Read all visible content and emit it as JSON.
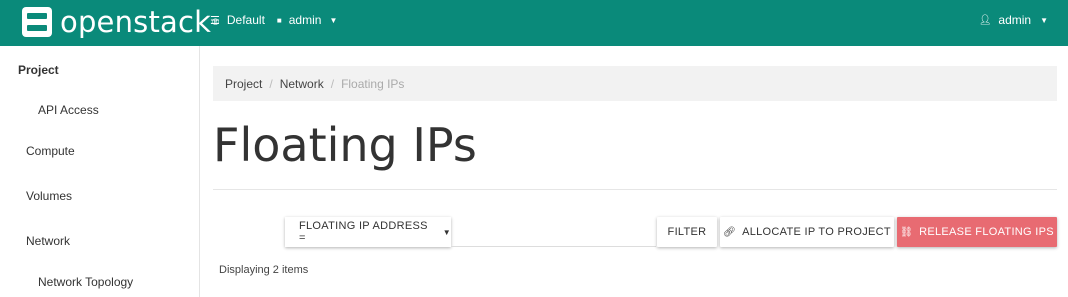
{
  "topbar": {
    "brand_name": "openstack",
    "brand_mark": "®",
    "domain_label": "Default",
    "project_label": "admin",
    "user_label": "admin",
    "bg_color": "#0a8a7a"
  },
  "sidebar": {
    "items": [
      {
        "label": "Project",
        "level": "panel"
      },
      {
        "label": "API Access",
        "level": "item"
      },
      {
        "label": "Compute",
        "level": "group"
      },
      {
        "label": "Volumes",
        "level": "group"
      },
      {
        "label": "Network",
        "level": "group"
      },
      {
        "label": "Network Topology",
        "level": "item"
      }
    ]
  },
  "breadcrumb": {
    "items": [
      "Project",
      "Network",
      "Floating IPs"
    ],
    "separator": "/"
  },
  "page": {
    "title": "Floating IPs",
    "item_count_text": "Displaying 2 items"
  },
  "toolbar": {
    "filter_field_label": "FLOATING IP ADDRESS =",
    "filter_input_value": "",
    "filter_button": "FILTER",
    "allocate_button": "ALLOCATE IP TO PROJECT",
    "release_button": "RELEASE FLOATING IPS",
    "release_color": "#e86b72"
  },
  "icons": {
    "logo": "openstack-logo-icon",
    "domain": "list-icon",
    "project": "square-icon",
    "user": "user-icon",
    "caret": "chevron-down-icon",
    "allocate": "link-icon",
    "release": "unlink-icon"
  }
}
